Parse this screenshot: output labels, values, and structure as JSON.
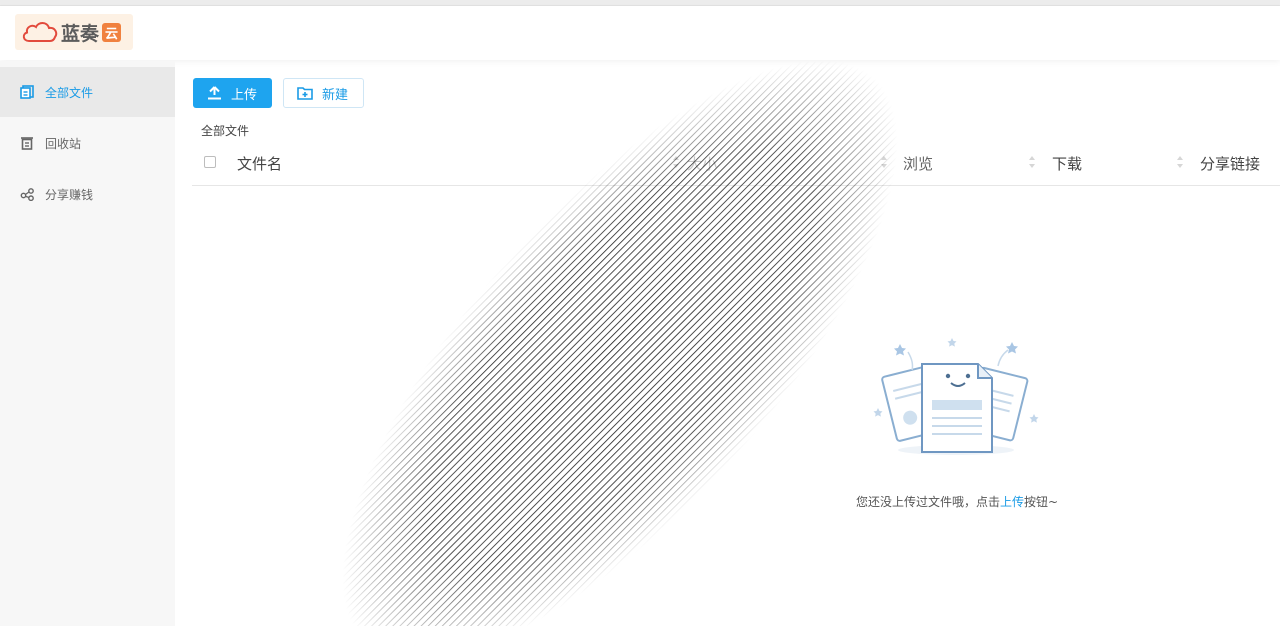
{
  "app": {
    "logo_text": "蓝奏",
    "logo_box": "云"
  },
  "sidebar": {
    "items": [
      {
        "label": "全部文件",
        "icon": "files-icon",
        "active": true
      },
      {
        "label": "回收站",
        "icon": "trash-icon",
        "active": false
      },
      {
        "label": "分享赚钱",
        "icon": "share-icon",
        "active": false
      }
    ]
  },
  "toolbar": {
    "upload_label": "上传",
    "new_label": "新建"
  },
  "breadcrumb": "全部文件",
  "table": {
    "columns": [
      "文件名",
      "大小",
      "浏览",
      "下载",
      "分享链接"
    ]
  },
  "empty": {
    "text_before": "您还没上传过文件哦，点击",
    "link": "上传",
    "text_after": "按钮~"
  },
  "colors": {
    "accent": "#1ea4ef",
    "link": "#1a9be6",
    "logo_orange": "#f0813f"
  }
}
